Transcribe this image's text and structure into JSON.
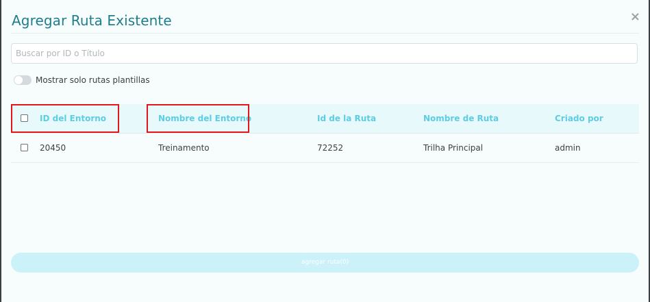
{
  "modal": {
    "title": "Agregar Ruta Existente",
    "close_symbol": "×"
  },
  "search": {
    "placeholder": "Buscar por ID o Título",
    "value": ""
  },
  "toggle": {
    "label": "Mostrar solo rutas plantillas",
    "checked": false
  },
  "table": {
    "columns": [
      "ID del Entorno",
      "Nombre del Entorno",
      "Id de la Ruta",
      "Nombre de Ruta",
      "Criado por"
    ],
    "rows": [
      [
        "20450",
        "Treinamento",
        "72252",
        "Trilha Principal",
        "admin"
      ]
    ]
  },
  "submit": {
    "label": "agregar ruta(0)"
  },
  "colors": {
    "title": "#1f7d8c",
    "header_text": "#5ccde3",
    "header_bg": "#e8f9fc",
    "highlight": "#e4141b",
    "button_bg": "#cbf2f9"
  },
  "icons": {
    "close": "close-icon"
  }
}
